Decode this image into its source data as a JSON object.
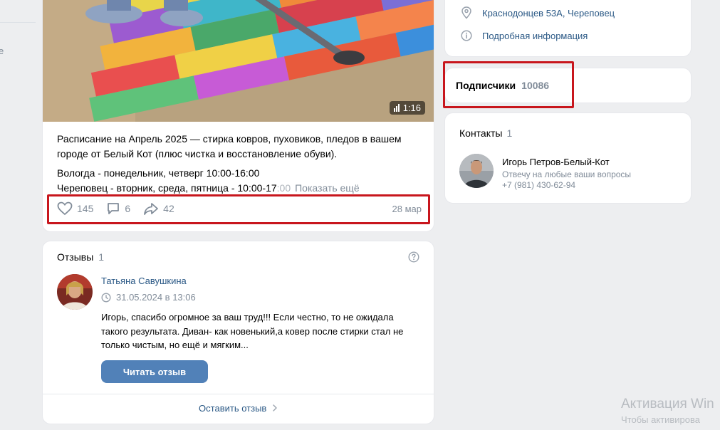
{
  "left_rail": {
    "fragment": "е"
  },
  "post": {
    "video_duration": "1:16",
    "title_line": "Расписание на Апрель 2025 — стирка ковров, пуховиков, пледов в вашем городе от Белый Кот (плюс чистка и восстановление обуви).",
    "line_vologda": "Вологда - понедельник, четверг 10:00-16:00",
    "line_cherepovets_main": "Череповец - вторник, среда, пятница - 10:00-17",
    "line_cherepovets_fade": ":00",
    "show_more": "Показать ещё",
    "likes": "145",
    "comments": "6",
    "shares": "42",
    "date": "28 мар"
  },
  "reviews": {
    "title": "Отзывы",
    "count": "1",
    "author": "Татьяна Савушкина",
    "date": "31.05.2024 в 13:06",
    "text": "Игорь, спасибо огромное за ваш труд!!! Если честно, то не ожидала такого результата. Диван- как новенький,а ковер после стирки стал не только чистым, но ещё и мягким...",
    "read_button": "Читать отзыв",
    "leave_review": "Оставить отзыв"
  },
  "info": {
    "address": "Краснодонцев 53А, Череповец",
    "details": "Подробная информация"
  },
  "subscribers": {
    "label": "Подписчики",
    "count": "10086"
  },
  "contacts": {
    "title": "Контакты",
    "count": "1",
    "name": "Игорь Петров-Белый-Кот",
    "subtitle": "Отвечу на любые ваши вопросы",
    "phone": "+7 (981) 430-62-94"
  },
  "watermark": {
    "line1": "Активация Win",
    "line2": "Чтобы активирова"
  },
  "colors": {
    "link": "#2a5885",
    "secondary": "#818c99",
    "button": "#5181b8",
    "highlight": "#c8161d",
    "background": "#edeef0"
  }
}
